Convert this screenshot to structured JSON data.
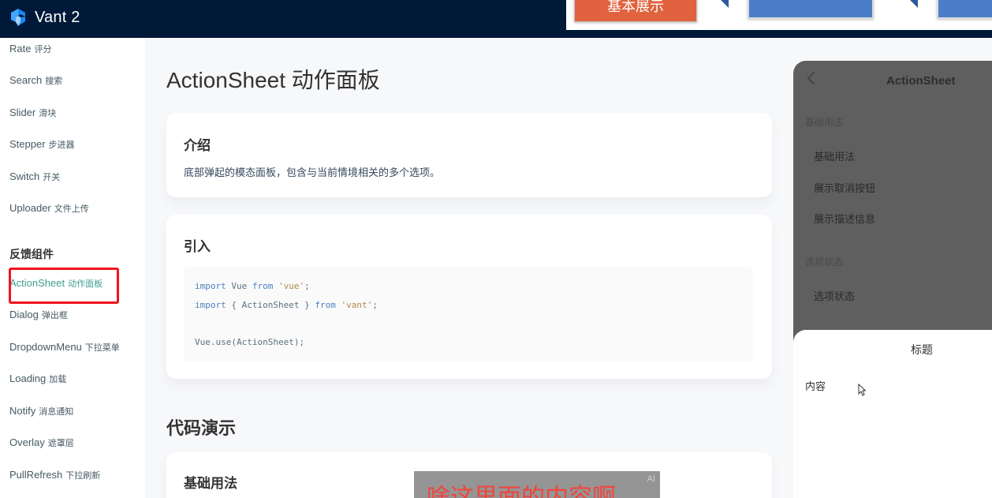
{
  "header": {
    "logo_text": "Vant 2",
    "slide_red_label": "基本展示"
  },
  "sidebar": {
    "items_top": [
      {
        "en": "Rate",
        "zh": "评分"
      },
      {
        "en": "Search",
        "zh": "搜索"
      },
      {
        "en": "Slider",
        "zh": "滑块"
      },
      {
        "en": "Stepper",
        "zh": "步进器"
      },
      {
        "en": "Switch",
        "zh": "开关"
      },
      {
        "en": "Uploader",
        "zh": "文件上传"
      }
    ],
    "group_label": "反馈组件",
    "items_feedback": [
      {
        "en": "ActionSheet",
        "zh": "动作面板"
      },
      {
        "en": "Dialog",
        "zh": "弹出框"
      },
      {
        "en": "DropdownMenu",
        "zh": "下拉菜单"
      },
      {
        "en": "Loading",
        "zh": "加载"
      },
      {
        "en": "Notify",
        "zh": "消息通知"
      },
      {
        "en": "Overlay",
        "zh": "遮罩层"
      },
      {
        "en": "PullRefresh",
        "zh": "下拉刷新"
      }
    ]
  },
  "main": {
    "page_title": "ActionSheet 动作面板",
    "intro": {
      "heading": "介绍",
      "text": "底部弹起的模态面板，包含与当前情境相关的多个选项。"
    },
    "import": {
      "heading": "引入",
      "line1": {
        "kw1": "import",
        "id": " Vue ",
        "kw2": "from",
        "str": " 'vue'",
        "end": ";"
      },
      "line2": {
        "kw1": "import",
        "id": " { ActionSheet } ",
        "kw2": "from",
        "str": " 'vant'",
        "end": ";"
      },
      "line3": "Vue.use(ActionSheet);"
    },
    "demo_title": "代码演示",
    "basic_usage_heading": "基础用法"
  },
  "caption": {
    "text": "啥这里面的内容啊",
    "badge": "AI"
  },
  "phone": {
    "title": "ActionSheet",
    "group1": "基础用法",
    "items1": [
      "基础用法",
      "展示取消按钮",
      "展示描述信息"
    ],
    "group2": "选项状态",
    "items2": [
      "选项状态"
    ],
    "sheet_title": "标题",
    "sheet_content": "内容"
  },
  "colors": {
    "header_bg": "#001938",
    "active_nav": "#3f9e8f",
    "highlight_box": "#f2141c"
  }
}
